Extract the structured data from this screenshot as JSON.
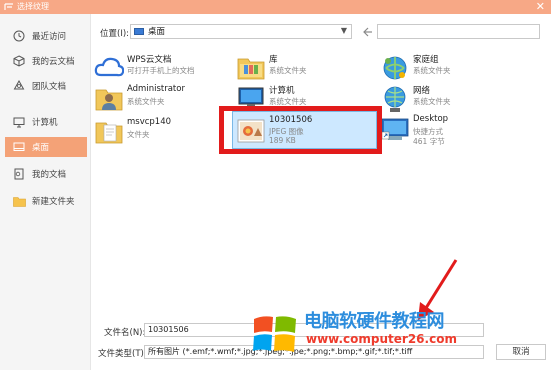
{
  "window": {
    "title": "选择纹理",
    "close_glyph": "✕"
  },
  "sidebar": {
    "items": [
      {
        "label": "最近访问",
        "icon": "clock-icon"
      },
      {
        "label": "我的云文档",
        "icon": "cube-icon"
      },
      {
        "label": "团队文档",
        "icon": "team-icon"
      },
      {
        "label": "计算机",
        "icon": "monitor-icon"
      },
      {
        "label": "桌面",
        "icon": "desktop-icon",
        "active": true
      },
      {
        "label": "我的文档",
        "icon": "document-icon"
      },
      {
        "label": "新建文件夹",
        "icon": "folder-icon"
      }
    ]
  },
  "toolbar": {
    "location_label": "位置(I):",
    "location_value": "桌面",
    "location_icon": "desktop-small-icon",
    "search_placeholder": ""
  },
  "files": [
    {
      "name": "WPS云文档",
      "desc": "可打开手机上的文档",
      "size": "",
      "icon": "wps-cloud-icon"
    },
    {
      "name": "库",
      "desc": "系统文件夹",
      "size": "",
      "icon": "library-icon"
    },
    {
      "name": "家庭组",
      "desc": "系统文件夹",
      "size": "",
      "icon": "homegroup-icon"
    },
    {
      "name": "Administrator",
      "desc": "系统文件夹",
      "size": "",
      "icon": "user-folder-icon"
    },
    {
      "name": "计算机",
      "desc": "系统文件夹",
      "size": "",
      "icon": "computer-icon"
    },
    {
      "name": "网络",
      "desc": "系统文件夹",
      "size": "",
      "icon": "network-icon"
    },
    {
      "name": "msvcp140",
      "desc": "文件夹",
      "size": "",
      "icon": "folder-file-icon"
    },
    {
      "name": "10301506",
      "desc": "JPEG 图像",
      "size": "189 KB",
      "icon": "jpeg-image-icon",
      "selected": true
    },
    {
      "name": "Desktop",
      "desc": "快捷方式",
      "size": "461 字节",
      "icon": "shortcut-icon"
    }
  ],
  "bottom": {
    "filename_label": "文件名(N):",
    "filename_value": "10301506",
    "filetype_label": "文件类型(T):",
    "filetype_value": "所有图片 (*.emf;*.wmf;*.jpg;*.jpeg;*.jpe;*.png;*.bmp;*.gif;*.tif;*.tiff",
    "cancel_label": "取消"
  },
  "watermark": {
    "title": "电脑软硬件教程网",
    "url": "www.computer26.com"
  },
  "colors": {
    "accent": "#f4a277",
    "titlebar": "#f7a886",
    "highlight": "#e21b1b",
    "watermark_blue": "#2d8ddd",
    "watermark_red": "#ef3b2c"
  }
}
